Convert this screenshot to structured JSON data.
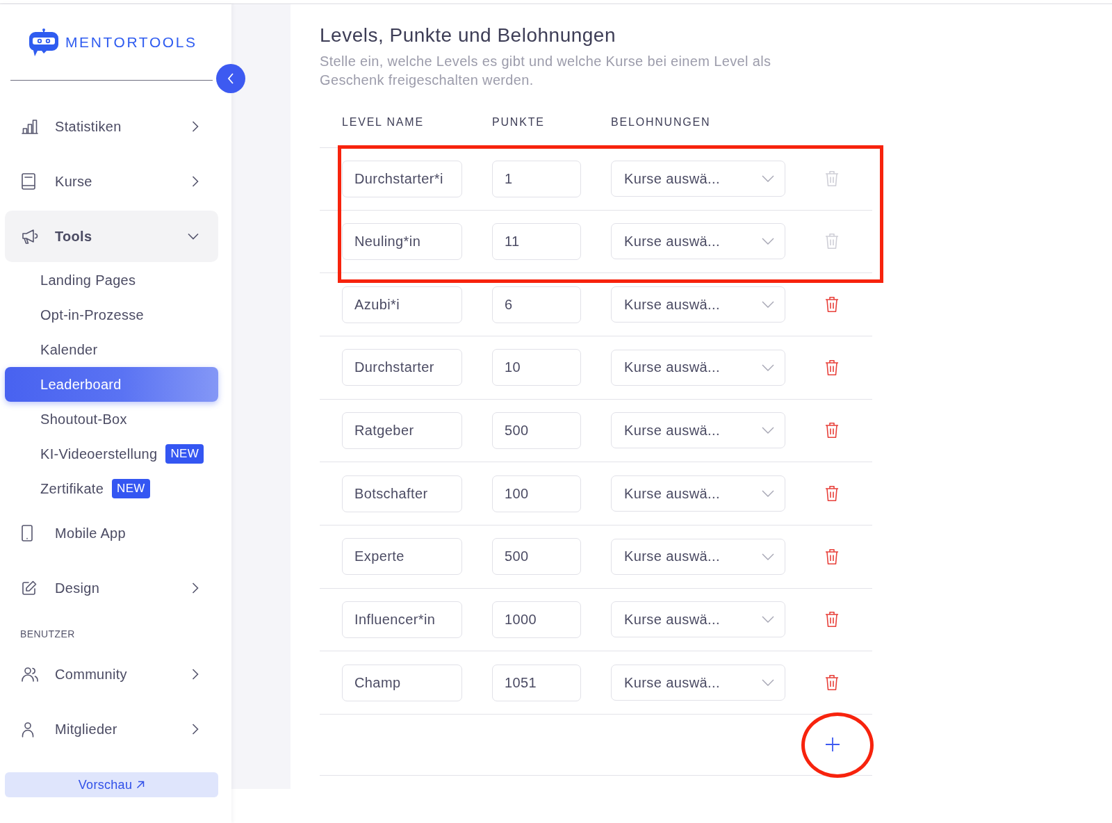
{
  "logo": {
    "text": "MENTORTOOLS"
  },
  "sidebar": {
    "sections": [
      {
        "items": [
          {
            "label": "Statistiken",
            "expandable": true,
            "expanded": false
          },
          {
            "label": "Kurse",
            "expandable": true,
            "expanded": false
          },
          {
            "label": "Tools",
            "expandable": true,
            "expanded": true,
            "children": [
              {
                "label": "Landing Pages",
                "selected": false
              },
              {
                "label": "Opt-in-Prozesse",
                "selected": false
              },
              {
                "label": "Kalender",
                "selected": false
              },
              {
                "label": "Leaderboard",
                "selected": true
              },
              {
                "label": "Shoutout-Box",
                "selected": false
              },
              {
                "label": "KI-Videoerstellung",
                "selected": false,
                "badge": "NEW"
              },
              {
                "label": "Zertifikate",
                "selected": false,
                "badge": "NEW"
              }
            ]
          },
          {
            "label": "Mobile App",
            "expandable": false,
            "expanded": false
          },
          {
            "label": "Design",
            "expandable": true,
            "expanded": false
          }
        ]
      },
      {
        "label": "BENUTZER",
        "items": [
          {
            "label": "Community",
            "expandable": true,
            "expanded": false
          },
          {
            "label": "Mitglieder",
            "expandable": true,
            "expanded": false
          }
        ]
      }
    ],
    "preview_button": {
      "label": "Vorschau"
    }
  },
  "page": {
    "title": "Levels, Punkte und Belohnungen",
    "description": "Stelle ein, welche Levels es gibt und welche Kurse bei einem Level als Geschenk freigeschalten werden."
  },
  "table": {
    "columns": [
      "LEVEL NAME",
      "PUNKTE",
      "BELOHNUNGEN"
    ],
    "rows": [
      {
        "name": "Durchstarter*i",
        "points": "1",
        "rewards": "Kurse auswä...",
        "deletable": false,
        "highlighted": true
      },
      {
        "name": "Neuling*in",
        "points": "11",
        "rewards": "Kurse auswä...",
        "deletable": false,
        "highlighted": true
      },
      {
        "name": "Azubi*i",
        "points": "6",
        "rewards": "Kurse auswä...",
        "deletable": true,
        "highlighted": false
      },
      {
        "name": "Durchstarter",
        "points": "10",
        "rewards": "Kurse auswä...",
        "deletable": true,
        "highlighted": false
      },
      {
        "name": "Ratgeber",
        "points": "500",
        "rewards": "Kurse auswä...",
        "deletable": true,
        "highlighted": false
      },
      {
        "name": "Botschafter",
        "points": "100",
        "rewards": "Kurse auswä...",
        "deletable": true,
        "highlighted": false
      },
      {
        "name": "Experte",
        "points": "500",
        "rewards": "Kurse auswä...",
        "deletable": true,
        "highlighted": false
      },
      {
        "name": "Influencer*in",
        "points": "1000",
        "rewards": "Kurse auswä...",
        "deletable": true,
        "highlighted": false
      },
      {
        "name": "Champ",
        "points": "1051",
        "rewards": "Kurse auswä...",
        "deletable": true,
        "highlighted": false
      }
    ],
    "add_button": {
      "highlighted": true
    }
  }
}
